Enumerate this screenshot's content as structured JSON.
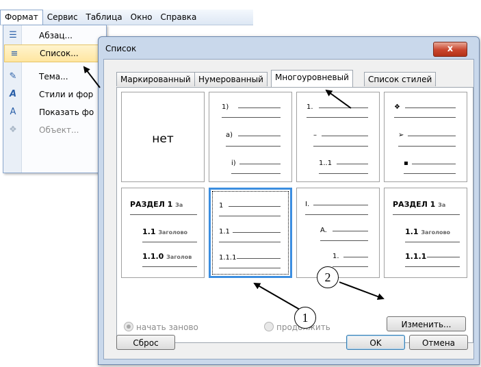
{
  "menubar": {
    "items": [
      "Формат",
      "Сервис",
      "Таблица",
      "Окно",
      "Справка"
    ]
  },
  "format_menu": {
    "items": [
      {
        "label": "Абзац...",
        "icon": "paragraph-icon"
      },
      {
        "label": "Список...",
        "icon": "list-icon",
        "highlighted": true
      },
      {
        "label": "Тема...",
        "icon": "theme-icon"
      },
      {
        "label": "Стили и фор",
        "icon": "styles-icon"
      },
      {
        "label": "Показать фо",
        "icon": "reveal-formatting-icon"
      },
      {
        "label": "Объект...",
        "icon": "object-icon",
        "disabled": true
      }
    ]
  },
  "dialog": {
    "title": "Список",
    "close": "x",
    "tabs": [
      "Маркированный",
      "Нумерованный",
      "Многоуровневый",
      "Список стилей"
    ],
    "active_tab": "Многоуровневый",
    "gallery": {
      "none_label": "нет",
      "cell2": [
        "1)",
        "а)",
        "i)"
      ],
      "cell3": [
        "1.",
        "–",
        "1..1"
      ],
      "cell4": [
        "❖",
        "➢",
        "▪"
      ],
      "cell5": {
        "l1": "РАЗДЕЛ 1",
        "l1s": "За",
        "l2": "1.1",
        "l2s": "Заголово",
        "l3": "1.1.0",
        "l3s": "Заголов"
      },
      "cell6": [
        "1",
        "1.1",
        "1.1.1"
      ],
      "cell7": [
        "I.",
        "A.",
        "1."
      ],
      "cell8": {
        "l1": "РАЗДЕЛ 1",
        "l1s": "За",
        "l2": "1.1",
        "l2s": "Заголово",
        "l3": "1.1.1"
      }
    },
    "restart_label": "начать заново",
    "continue_label": "продолжить",
    "modify_button": "Изменить...",
    "reset_button": "Сброс",
    "ok_button": "OK",
    "cancel_button": "Отмена"
  },
  "callouts": [
    "1",
    "2"
  ]
}
